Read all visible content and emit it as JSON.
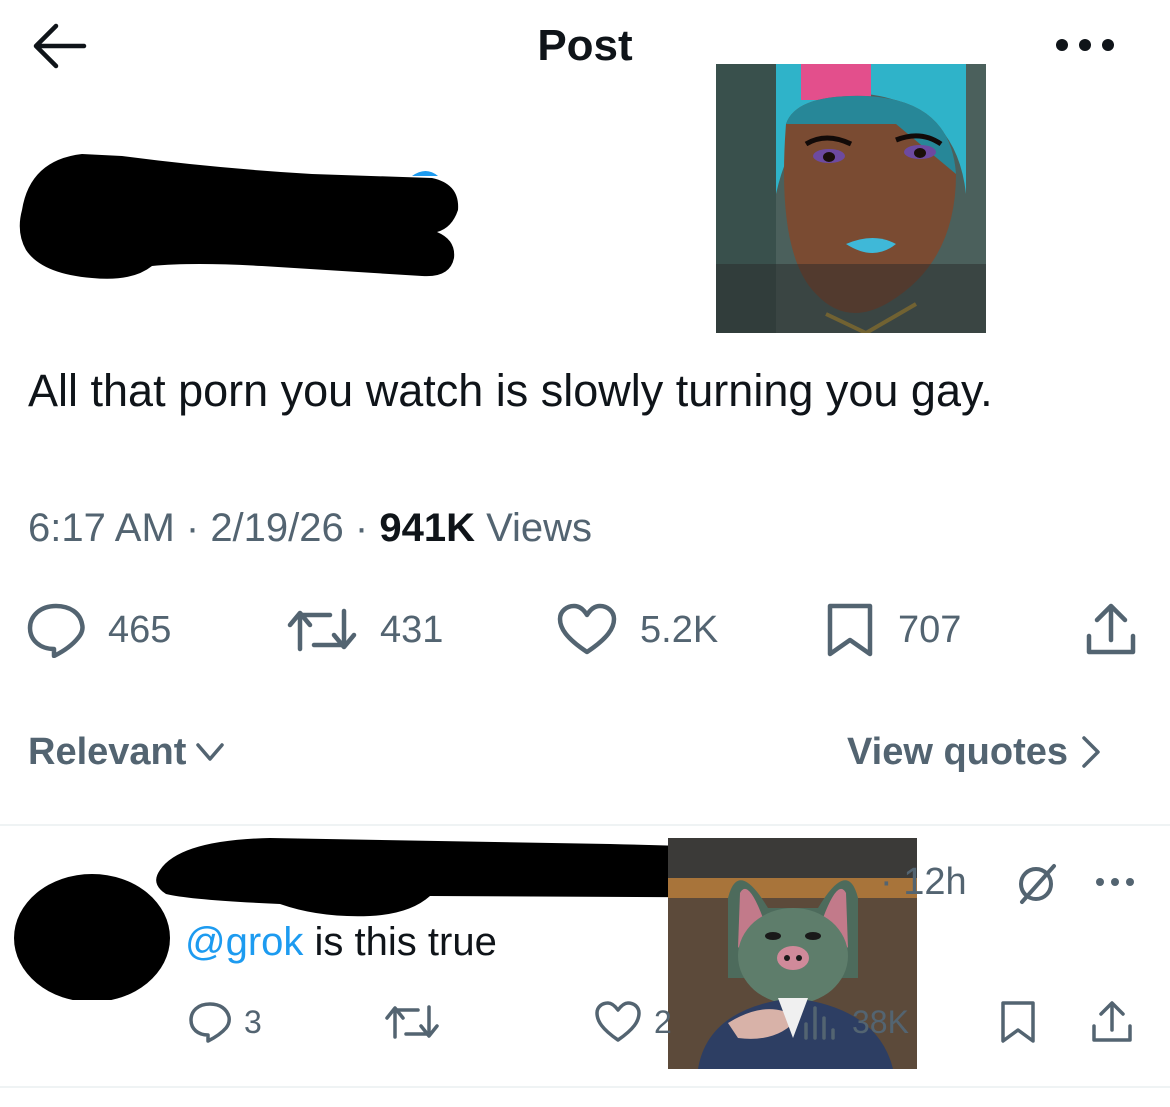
{
  "header": {
    "title": "Post",
    "back_icon": "arrow-left-icon",
    "more_icon": "more-horizontal-icon"
  },
  "post": {
    "text": "All that porn you watch is slowly turning you gay.",
    "time": "6:17 AM",
    "date": "2/19/26",
    "views_count": "941K",
    "views_label": "Views",
    "stats": {
      "replies": "465",
      "reposts": "431",
      "likes": "5.2K",
      "bookmarks": "707"
    }
  },
  "sort": {
    "relevant_label": "Relevant",
    "view_quotes_label": "View quotes"
  },
  "reply": {
    "time": "12h",
    "mention": "@grok",
    "text": " is this true",
    "stats": {
      "replies": "3",
      "likes": "2",
      "views": "38K"
    }
  },
  "colors": {
    "text_primary": "#0f1419",
    "text_secondary": "#536471",
    "accent": "#1d9bf0",
    "divider": "#eff3f4"
  }
}
